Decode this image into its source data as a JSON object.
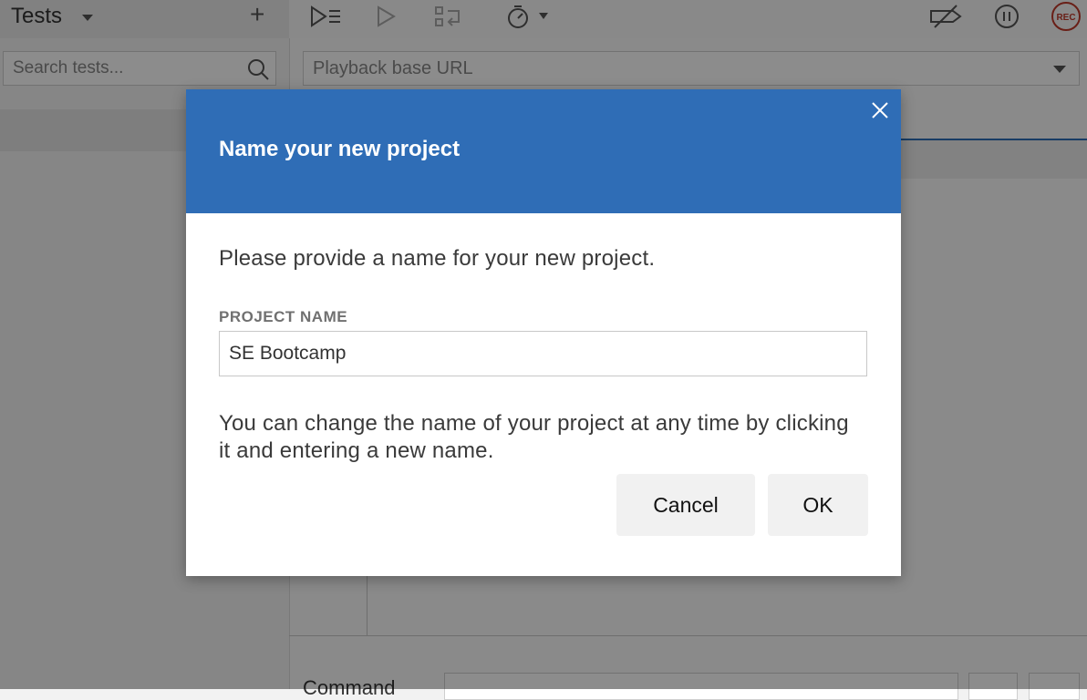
{
  "sidebar": {
    "title": "Tests",
    "search_placeholder": "Search tests..."
  },
  "main": {
    "url_placeholder": "Playback base URL",
    "command_label": "Command",
    "record_label": "REC"
  },
  "modal": {
    "title": "Name your new project",
    "description": "Please provide a name for your new project.",
    "field_label": "PROJECT NAME",
    "field_value": "SE Bootcamp",
    "note": "You can change the name of your project at any time by clicking it and entering a new name.",
    "cancel_label": "Cancel",
    "ok_label": "OK"
  },
  "colors": {
    "accent": "#2f6db6",
    "record": "#c0392b"
  }
}
